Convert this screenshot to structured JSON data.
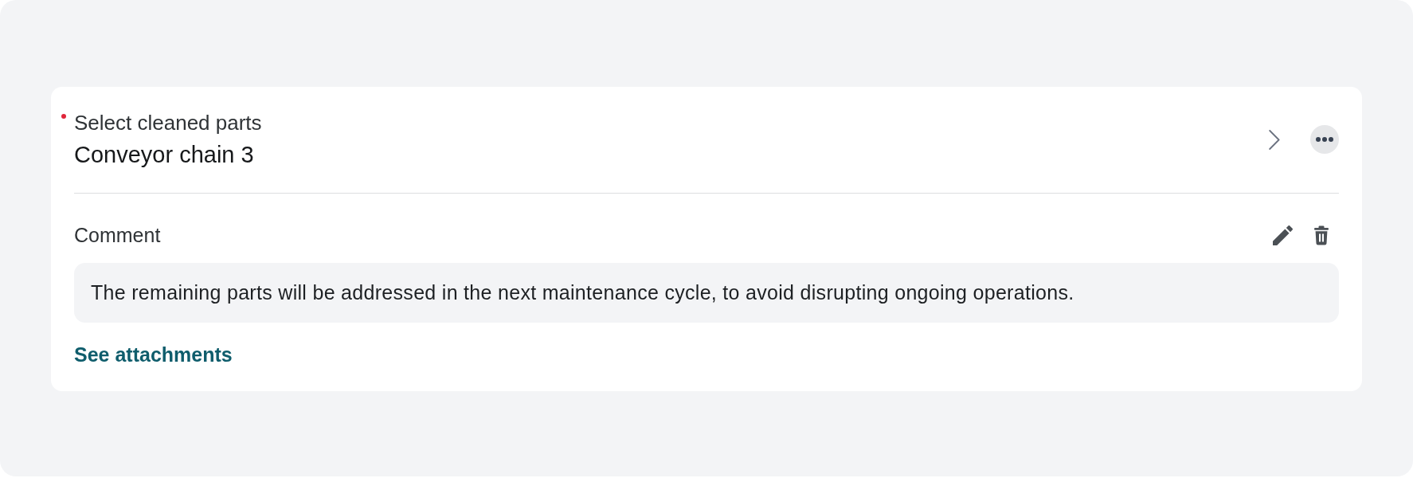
{
  "field": {
    "label": "Select cleaned parts",
    "required": true,
    "value": "Conveyor chain 3"
  },
  "comment": {
    "label": "Comment",
    "text": "The remaining parts will be addressed in the next maintenance cycle, to avoid disrupting ongoing operations."
  },
  "link": {
    "label": "See attachments"
  }
}
